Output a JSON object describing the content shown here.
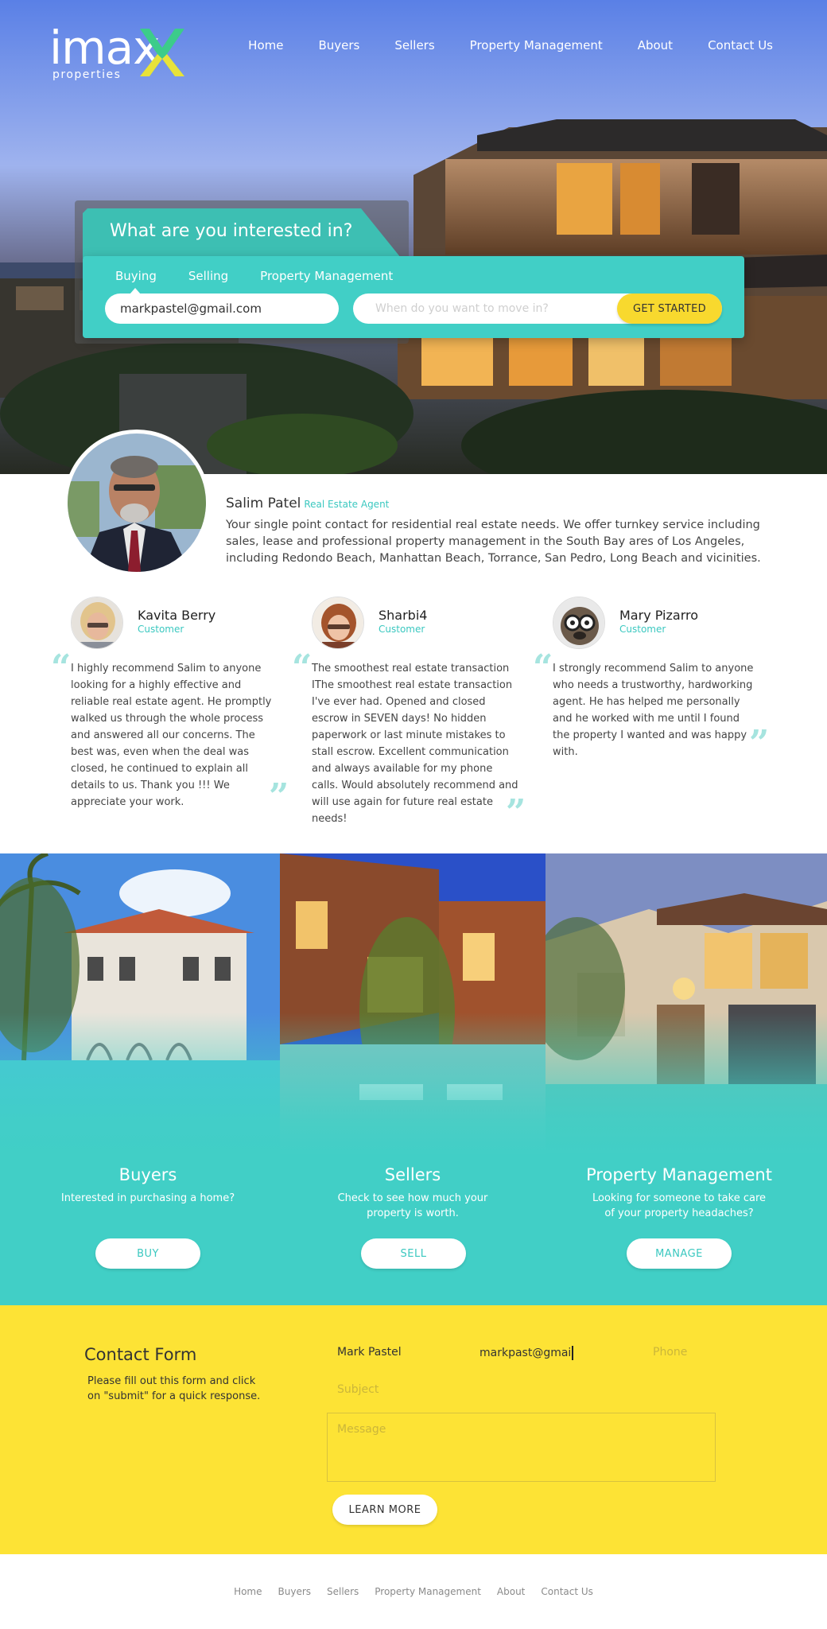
{
  "brand": {
    "name": "imax",
    "sub": "properties",
    "colors": {
      "teal": "#41cfc6",
      "yellow": "#fde335",
      "button_yellow": "#f8d92e",
      "logo_green": "#3ccc8a",
      "logo_yellow": "#e8e23a"
    }
  },
  "nav": {
    "items": [
      "Home",
      "Buyers",
      "Sellers",
      "Property Management",
      "About",
      "Contact Us"
    ]
  },
  "search": {
    "title": "What are you interested in?",
    "modes": [
      "Buying",
      "Selling",
      "Property Management"
    ],
    "selected_mode": "Buying",
    "email_value": "markpastel@gmail.com",
    "move_placeholder": "When do you want to move in?",
    "button_label": "GET STARTED"
  },
  "agent": {
    "name": "Salim Patel",
    "role": "Real Estate Agent",
    "description": "Your single point contact for residential real estate needs. We offer turnkey service including sales, lease and professional property management in the South Bay ares of Los Angeles, including Redondo Beach, Manhattan Beach, Torrance, San Pedro, Long Beach and vicinities."
  },
  "testimonials": [
    {
      "name": "Kavita Berry",
      "role": "Customer",
      "quote": "I highly recommend Salim to anyone looking for a highly effective and reliable real estate agent. He promptly walked us through the whole process and answered all our concerns. The best was, even when the deal was closed, he continued to explain all details to us. Thank you !!! We appreciate your work."
    },
    {
      "name": "Sharbi4",
      "role": "Customer",
      "quote": "The smoothest real estate transaction IThe smoothest real estate transaction I've ever had. Opened and closed escrow in SEVEN days! No hidden paperwork or last minute mistakes to stall escrow. Excellent communication and always available for my phone calls. Would absolutely recommend and will use again for future real estate needs!"
    },
    {
      "name": "Mary Pizarro",
      "role": "Customer",
      "quote": "I strongly recommend Salim to anyone who needs a trustworthy, hardworking agent. He has helped me personally and he worked with me until I found the property I wanted and was happy with."
    }
  ],
  "services": [
    {
      "title": "Buyers",
      "text": "Interested in purchasing a home?",
      "button": "BUY"
    },
    {
      "title": "Sellers",
      "text": "Check to see how much your property is worth.",
      "button": "SELL"
    },
    {
      "title": "Property Management",
      "text": "Looking for someone to take care of your property headaches?",
      "button": "MANAGE"
    }
  ],
  "contact": {
    "title": "Contact Form",
    "description": "Please fill out this form and click on \"submit\" for a quick response.",
    "name_value": "Mark Pastel",
    "email_value": "markpast@gmai",
    "phone_placeholder": "Phone",
    "subject_placeholder": "Subject",
    "message_placeholder": "Message",
    "button_label": "LEARN MORE"
  },
  "footer": {
    "items": [
      "Home",
      "Buyers",
      "Sellers",
      "Property Management",
      "About",
      "Contact Us"
    ]
  }
}
